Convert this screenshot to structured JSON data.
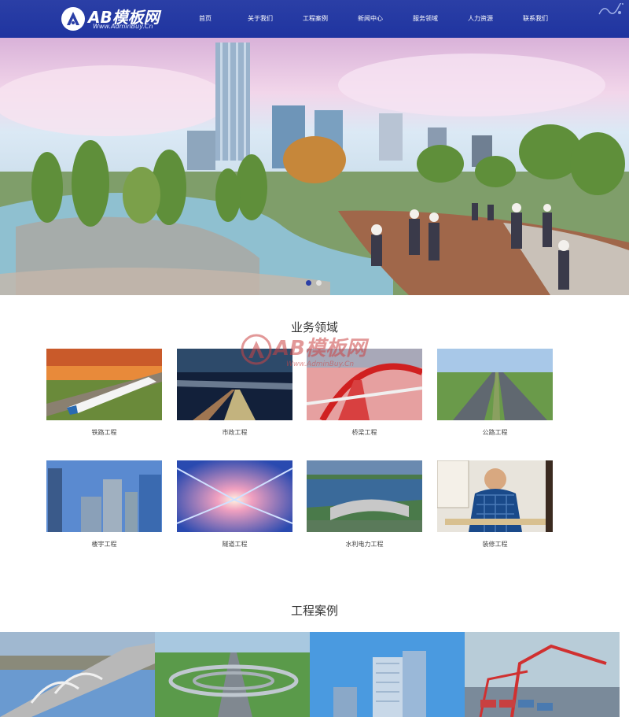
{
  "header": {
    "logo_text": "AB模板网",
    "logo_sub": "Www.AdminBuy.Cn",
    "nav": [
      "首页",
      "关于我们",
      "工程案例",
      "新闻中心",
      "服务领域",
      "人力资源",
      "联系我们"
    ]
  },
  "colors": {
    "brand": "#2b3fa6",
    "watermark": "#cc4444"
  },
  "banner": {
    "slide_count": 2,
    "active_slide": 1
  },
  "services": {
    "title": "业务领域",
    "items": [
      {
        "label": "铁路工程",
        "icon": "railway-photo"
      },
      {
        "label": "市政工程",
        "icon": "municipal-photo"
      },
      {
        "label": "桥梁工程",
        "icon": "bridge-photo"
      },
      {
        "label": "公路工程",
        "icon": "highway-photo"
      },
      {
        "label": "楼宇工程",
        "icon": "building-photo"
      },
      {
        "label": "隧道工程",
        "icon": "tunnel-photo"
      },
      {
        "label": "水利电力工程",
        "icon": "dam-photo"
      },
      {
        "label": "装修工程",
        "icon": "decoration-photo"
      }
    ]
  },
  "watermark": {
    "text": "AB模板网",
    "sub": "Www.AdminBuy.Cn"
  },
  "cases": {
    "title": "工程案例",
    "items": [
      {
        "icon": "arch-bridge-photo"
      },
      {
        "icon": "interchange-photo"
      },
      {
        "icon": "tower-photo"
      },
      {
        "icon": "port-crane-photo"
      }
    ]
  }
}
